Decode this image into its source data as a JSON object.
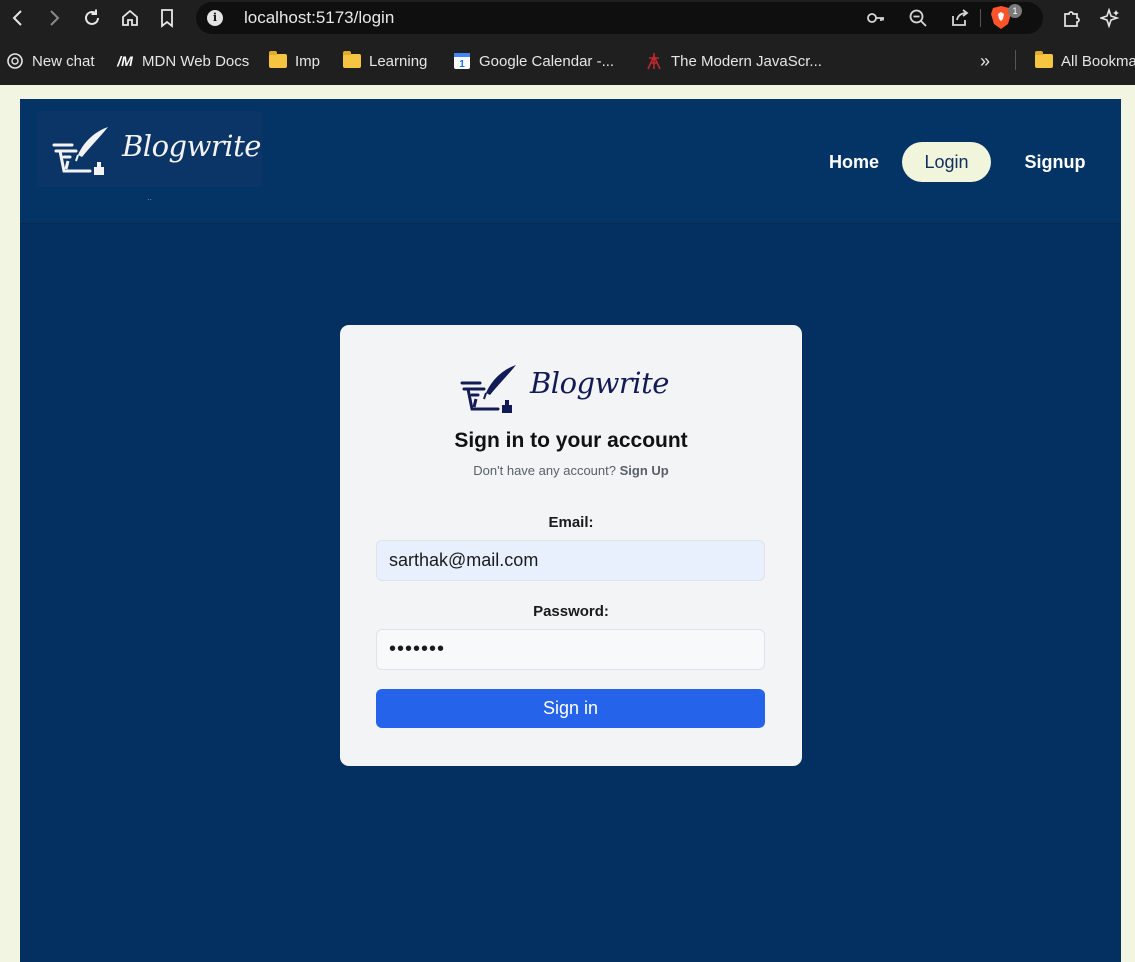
{
  "browser": {
    "url": "localhost:5173/login",
    "brave_badge": "1",
    "bookmarks": [
      {
        "label": "New chat",
        "icon": "openai-icon"
      },
      {
        "label": "MDN Web Docs",
        "icon": "mdn-icon"
      },
      {
        "label": "Imp",
        "icon": "folder-icon"
      },
      {
        "label": "Learning",
        "icon": "folder-icon"
      },
      {
        "label": "Google Calendar -...",
        "icon": "calendar-icon"
      },
      {
        "label": "The Modern JavaScr...",
        "icon": "js-site-icon"
      },
      {
        "label": "All Bookma",
        "icon": "folder-icon"
      }
    ],
    "overflow_label": "»"
  },
  "header": {
    "logo_text": "Blogwrite",
    "logo_dot": "..",
    "nav": [
      {
        "label": "Home",
        "active": false
      },
      {
        "label": "Login",
        "active": true
      },
      {
        "label": "Signup",
        "active": false
      }
    ]
  },
  "login": {
    "logo_text": "Blogwrite",
    "title": "Sign in to your account",
    "subtitle_prefix": "Don't have any account?",
    "subtitle_link": "Sign Up",
    "email_label": "Email:",
    "email_value": "sarthak@mail.com",
    "password_label": "Password:",
    "password_value": "•••••••",
    "submit_label": "Sign in"
  },
  "colors": {
    "page_bg": "#033061",
    "header_bg": "#033465",
    "active_nav_bg": "#f1f5dc",
    "button_bg": "#2563eb",
    "card_bg": "#f2f4f6"
  }
}
